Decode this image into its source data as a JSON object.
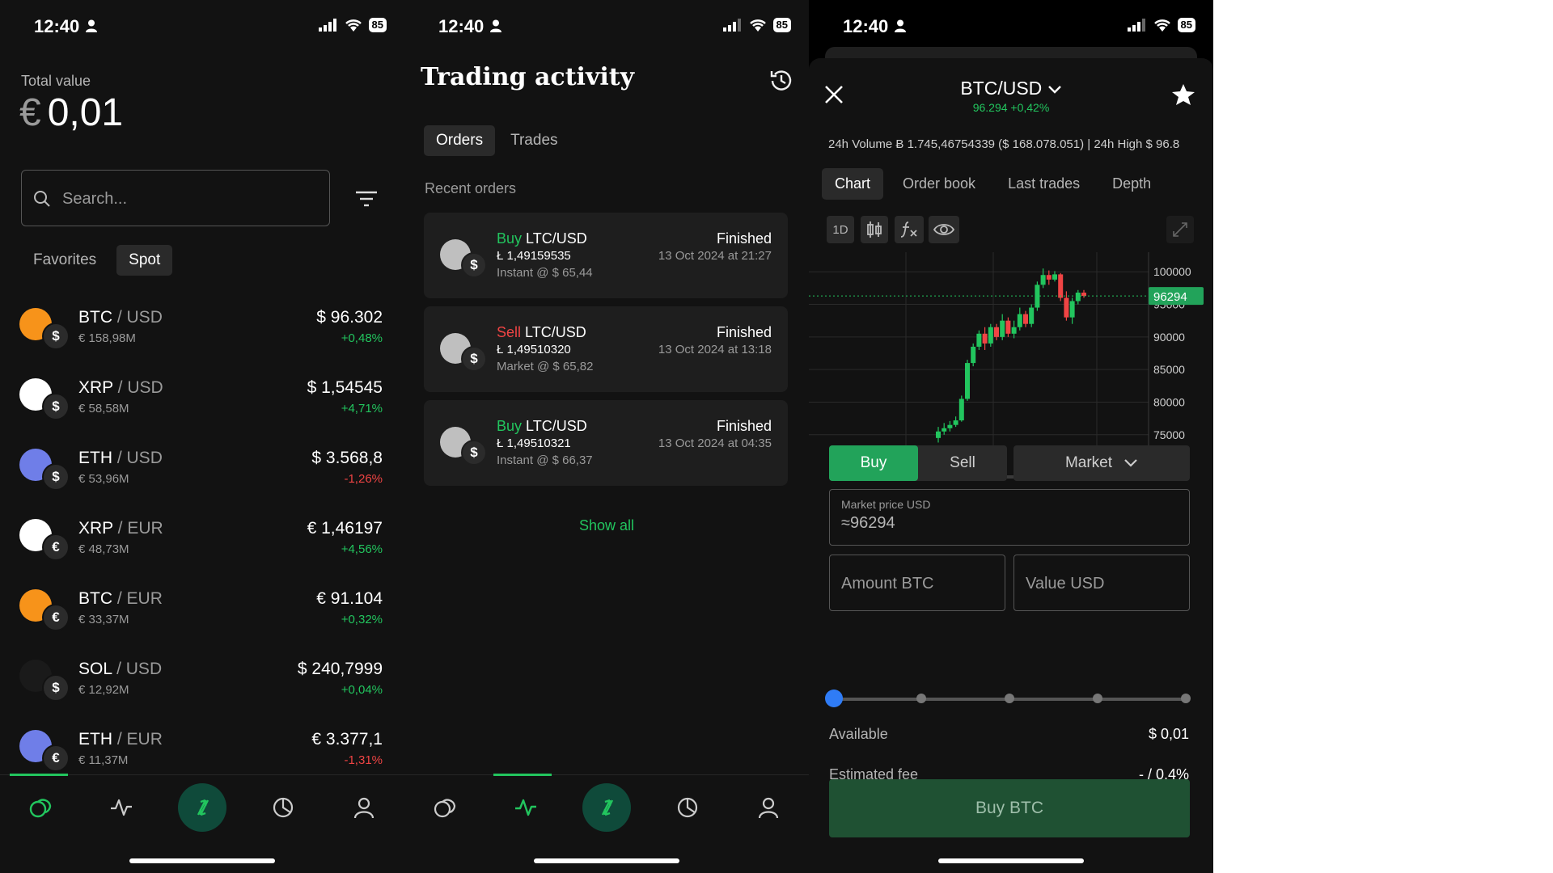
{
  "status": {
    "time": "12:40",
    "battery": "85"
  },
  "portfolio": {
    "total_label": "Total value",
    "total_currency": "€",
    "total_value": "0,01",
    "search_placeholder": "Search...",
    "tabs": [
      "Favorites",
      "Spot"
    ],
    "markets": [
      {
        "base": "BTC",
        "quote": "USD",
        "quote_sym": "$",
        "coin_color": "#f7931a",
        "volume": "€ 158,98M",
        "price": "$ 96.302",
        "change": "+0,48%",
        "dir": "up"
      },
      {
        "base": "XRP",
        "quote": "USD",
        "quote_sym": "$",
        "coin_color": "#ffffff",
        "volume": "€ 58,58M",
        "price": "$ 1,54545",
        "change": "+4,71%",
        "dir": "up"
      },
      {
        "base": "ETH",
        "quote": "USD",
        "quote_sym": "$",
        "coin_color": "#6f7ee8",
        "volume": "€ 53,96M",
        "price": "$ 3.568,8",
        "change": "-1,26%",
        "dir": "down"
      },
      {
        "base": "XRP",
        "quote": "EUR",
        "quote_sym": "€",
        "coin_color": "#ffffff",
        "volume": "€ 48,73M",
        "price": "€ 1,46197",
        "change": "+4,56%",
        "dir": "up"
      },
      {
        "base": "BTC",
        "quote": "EUR",
        "quote_sym": "€",
        "coin_color": "#f7931a",
        "volume": "€ 33,37M",
        "price": "€ 91.104",
        "change": "+0,32%",
        "dir": "up"
      },
      {
        "base": "SOL",
        "quote": "USD",
        "quote_sym": "$",
        "coin_color": "#1a1a1a",
        "volume": "€ 12,92M",
        "price": "$ 240,7999",
        "change": "+0,04%",
        "dir": "up"
      },
      {
        "base": "ETH",
        "quote": "EUR",
        "quote_sym": "€",
        "coin_color": "#6f7ee8",
        "volume": "€ 11,37M",
        "price": "€ 3.377,1",
        "change": "-1,31%",
        "dir": "down"
      }
    ]
  },
  "activity": {
    "title": "Trading activity",
    "tabs": [
      "Orders",
      "Trades"
    ],
    "recent_label": "Recent orders",
    "orders": [
      {
        "side": "Buy",
        "pair": "LTC/USD",
        "amount": "Ł 1,49159535",
        "exec": "Instant @ $ 65,44",
        "status": "Finished",
        "date": "13 Oct 2024 at 21:27"
      },
      {
        "side": "Sell",
        "pair": "LTC/USD",
        "amount": "Ł 1,49510320",
        "exec": "Market @ $ 65,82",
        "status": "Finished",
        "date": "13 Oct 2024 at 13:18"
      },
      {
        "side": "Buy",
        "pair": "LTC/USD",
        "amount": "Ł 1,49510321",
        "exec": "Instant @ $ 66,37",
        "status": "Finished",
        "date": "13 Oct 2024 at 04:35"
      }
    ],
    "show_all": "Show all"
  },
  "trade": {
    "pair": "BTC/USD",
    "price_line": "96.294 +0,42%",
    "stats": "24h Volume  Ƀ 1.745,46754339 ($ 168.078.051)   |   24h High  $ 96.8",
    "tabs": [
      "Chart",
      "Order book",
      "Last trades",
      "Depth"
    ],
    "interval": "1D",
    "current_price_tag": "96294",
    "order_side_buy": "Buy",
    "order_side_sell": "Sell",
    "order_type": "Market",
    "market_price_label": "Market price USD",
    "market_price_value": "≈96294",
    "amount_placeholder": "Amount BTC",
    "value_placeholder": "Value USD",
    "available_label": "Available",
    "available_value": "$ 0,01",
    "fee_label": "Estimated fee",
    "fee_value": "- / 0,4%",
    "buy_button": "Buy BTC"
  },
  "chart_data": {
    "type": "candlestick",
    "y_ticks": [
      75000,
      80000,
      85000,
      90000,
      95000,
      100000
    ],
    "ylim": [
      72000,
      103000
    ],
    "current_price": 96294,
    "candles": [
      [
        74500,
        75500,
        73800,
        76200
      ],
      [
        75500,
        76000,
        75000,
        76800
      ],
      [
        76000,
        76500,
        75500,
        77100
      ],
      [
        76500,
        77200,
        76200,
        77800
      ],
      [
        77200,
        80500,
        77000,
        81000
      ],
      [
        80500,
        86000,
        80200,
        86500
      ],
      [
        86000,
        88500,
        85500,
        89000
      ],
      [
        88500,
        90500,
        88000,
        91000
      ],
      [
        90500,
        89000,
        88000,
        91500
      ],
      [
        89000,
        91500,
        88500,
        92000
      ],
      [
        91500,
        90000,
        89500,
        92000
      ],
      [
        90000,
        92500,
        89500,
        93500
      ],
      [
        92500,
        90500,
        90000,
        93000
      ],
      [
        90500,
        91500,
        89800,
        92500
      ],
      [
        91500,
        93500,
        91000,
        94500
      ],
      [
        93500,
        92000,
        91500,
        94000
      ],
      [
        92000,
        94500,
        91500,
        95000
      ],
      [
        94500,
        98000,
        94000,
        98500
      ],
      [
        98000,
        99500,
        97500,
        100500
      ],
      [
        99500,
        98800,
        98000,
        100200
      ],
      [
        98800,
        99600,
        98500,
        100100
      ],
      [
        99600,
        96000,
        95500,
        99800
      ],
      [
        96000,
        93000,
        92500,
        97000
      ],
      [
        93000,
        95500,
        92000,
        96000
      ],
      [
        95500,
        96800,
        95000,
        97200
      ],
      [
        96800,
        96294,
        96000,
        97200
      ]
    ]
  }
}
